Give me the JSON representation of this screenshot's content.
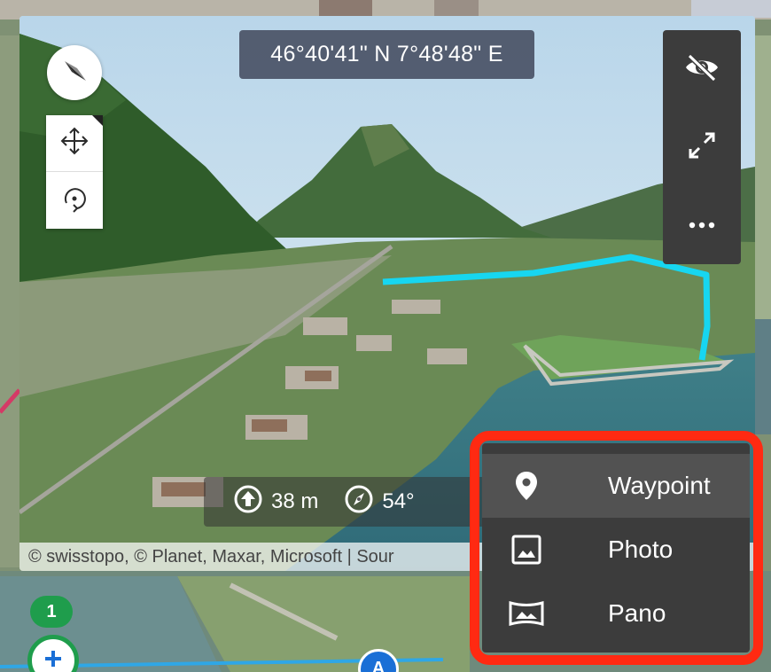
{
  "view3d": {
    "coordinates": "46°40'41\" N 7°48'48\" E",
    "stats": {
      "elevation": "38 m",
      "heading": "54°"
    },
    "attribution": "© swisstopo, © Planet, Maxar, Microsoft | Sour"
  },
  "toolbar": {
    "left": [
      "compass-icon",
      "move-icon",
      "rotate-icon"
    ],
    "right": [
      "visibility-off-icon",
      "fullscreen-icon",
      "more-icon"
    ]
  },
  "map": {
    "cluster_count": "1",
    "marker_label": "A",
    "route_color": "#17d6f0"
  },
  "menu": {
    "items": [
      {
        "label": "Waypoint",
        "icon": "pin-icon",
        "active": true
      },
      {
        "label": "Photo",
        "icon": "image-icon",
        "active": false
      },
      {
        "label": "Pano",
        "icon": "panorama-icon",
        "active": false
      }
    ],
    "highlight_color": "#ff2a12"
  }
}
